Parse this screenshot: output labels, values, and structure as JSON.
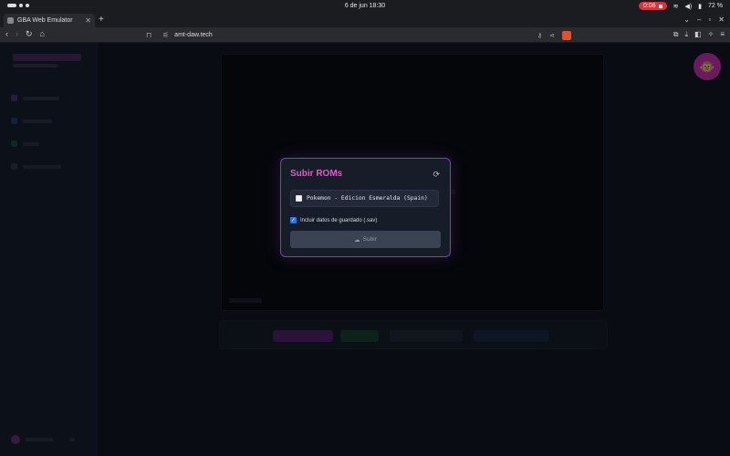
{
  "status_bar": {
    "date_time": "6 de jun  18:30",
    "recording_time": "0:08",
    "battery": "72 %"
  },
  "browser": {
    "tab_title": "GBA Web Emulator",
    "url": "amt-daw.tech"
  },
  "modal": {
    "title": "Subir ROMs",
    "rom_items": [
      {
        "label": "Pokemon - Edicion Esmeralda (Spain)",
        "checked": false
      }
    ],
    "include_saves_label": "Incluir datos de guardado (.sav)",
    "include_saves_checked": true,
    "upload_label": "Subir"
  },
  "colors": {
    "accent": "#d95fc4",
    "modal_border": "#8a3ab5",
    "avatar": "#c227a6",
    "checkbox": "#2a74e3"
  }
}
